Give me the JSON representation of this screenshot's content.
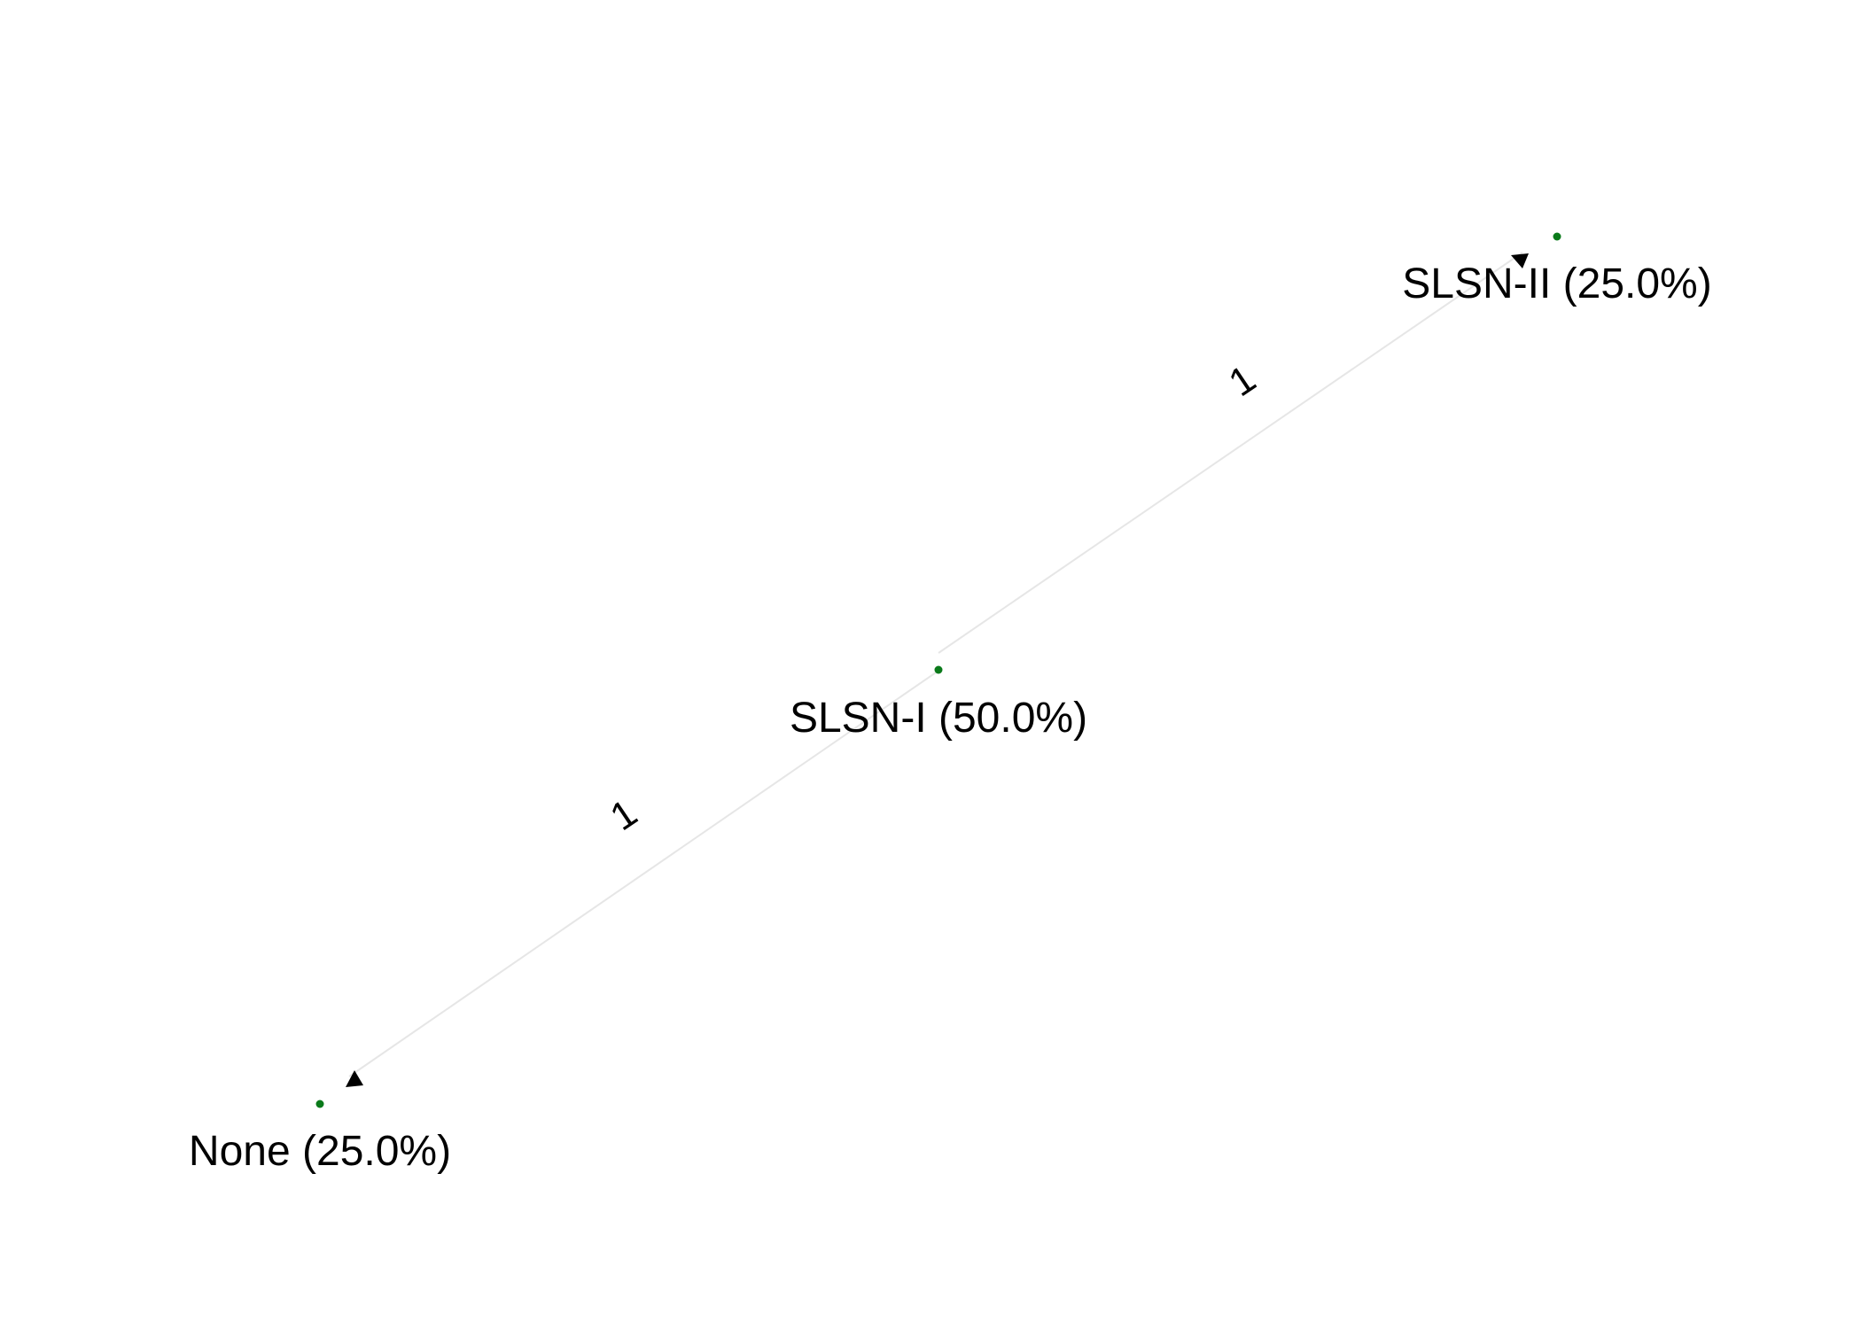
{
  "diagram": {
    "node_color": "#0a7a1a",
    "edge_color": "#e6e6e6",
    "arrow_color": "#000000",
    "nodes": [
      {
        "id": "slsn2",
        "label": "SLSN-II (25.0%)"
      },
      {
        "id": "slsn1",
        "label": "SLSN-I (50.0%)"
      },
      {
        "id": "none",
        "label": "None (25.0%)"
      }
    ],
    "edges": [
      {
        "from": "slsn1",
        "to": "slsn2",
        "label": "1"
      },
      {
        "from": "slsn1",
        "to": "none",
        "label": "1"
      }
    ]
  }
}
